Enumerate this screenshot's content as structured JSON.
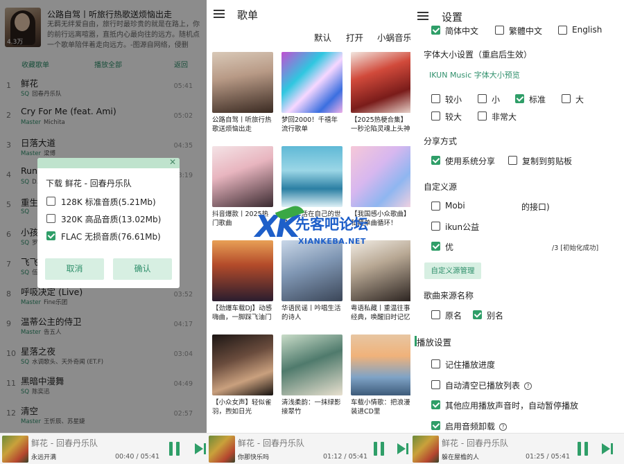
{
  "panel1": {
    "playlist_title": "公路自驾丨听旅行热歌送烦恼出走",
    "playlist_desc": "无羁无绊爱自由，旅行时最珍贵的就是在路上，你的前行远离喧嚣，直抵内心最向往的远方。随机点一个歌单陪伴着走向远方。-图源自网络，侵删",
    "play_count": "4.3万",
    "actions": {
      "collect": "收藏歌单",
      "play_all": "播放全部",
      "back": "返回"
    },
    "songs": [
      {
        "num": "1",
        "name": "鲜花",
        "tag": "SQ",
        "artist": "回春丹乐队",
        "dur": "05:41"
      },
      {
        "num": "2",
        "name": "Cry For Me (feat. Ami)",
        "tag": "Master",
        "artist": "Michita",
        "dur": "05:02"
      },
      {
        "num": "3",
        "name": "日落大道",
        "tag": "Master",
        "artist": "梁博",
        "dur": "04:35"
      },
      {
        "num": "4",
        "name": "Run",
        "tag": "SQ",
        "artist": "D.L",
        "dur": "03:19"
      },
      {
        "num": "5",
        "name": "重生",
        "tag": "SQ",
        "artist": "",
        "dur": ""
      },
      {
        "num": "6",
        "name": "小孩",
        "tag": "SQ",
        "artist": "罗",
        "dur": ""
      },
      {
        "num": "7",
        "name": "飞飞",
        "tag": "SQ",
        "artist": "伍",
        "dur": ""
      },
      {
        "num": "8",
        "name": "呼吸决定 (Live)",
        "tag": "Master",
        "artist": "Fine乐团",
        "dur": "03:52"
      },
      {
        "num": "9",
        "name": "温蒂公主的侍卫",
        "tag": "Master",
        "artist": "告五人",
        "dur": "04:17"
      },
      {
        "num": "10",
        "name": "星落之夜",
        "tag": "SQ",
        "artist": "水调歌头、天外奇闻 (ET.F)",
        "dur": "03:04"
      },
      {
        "num": "11",
        "name": "黑暗中漫舞",
        "tag": "SQ",
        "artist": "陈奕迅",
        "dur": "04:49"
      },
      {
        "num": "12",
        "name": "清空",
        "tag": "Master",
        "artist": "王忻辰、苏星婕",
        "dur": "02:57"
      }
    ],
    "dialog": {
      "title": "下载 鲜花 - 回春丹乐队",
      "options": [
        {
          "label": "128K 标准音质(5.21Mb)",
          "checked": false
        },
        {
          "label": "320K 高品音质(13.02Mb)",
          "checked": false
        },
        {
          "label": "FLAC 无损音质(76.61Mb)",
          "checked": true
        }
      ],
      "cancel": "取消",
      "confirm": "确认"
    },
    "player": {
      "title": "鲜花 - 回春丹乐队",
      "sub": "永远开满",
      "time": "00:40 / 05:41"
    }
  },
  "panel2": {
    "title": "歌单",
    "tabs": [
      "默认",
      "打开",
      "小蜗音乐"
    ],
    "cards": [
      {
        "text": "公路自驾丨听旅行热歌送烦恼出走"
      },
      {
        "text": "梦回2000！千禧年流行歌单"
      },
      {
        "text": "【2025热梗合集】一秒沦陷灵魂上头神曲"
      },
      {
        "text": "抖音爆款丨2025热门歌曲"
      },
      {
        "text": "孤岛丨活在自己的世界"
      },
      {
        "text": "【我国感小众歌曲】私藏单曲循环！"
      },
      {
        "text": "【劲爆车载DJ】动感嗨曲，一脚踩飞油门"
      },
      {
        "text": "华语民谣丨吟唱生活的诗人"
      },
      {
        "text": "粤语私藏丨重温往事经典，唤醒旧时记忆"
      },
      {
        "text": "【小众女声】轻似雀羽，煦如日光"
      },
      {
        "text": "清浅柔韵：一抹绿影接翠竹"
      },
      {
        "text": "车载小情歌：把浪漫装进CD里"
      }
    ],
    "player": {
      "title": "鲜花 - 回春丹乐队",
      "sub": "你那快乐吗",
      "time": "01:12 / 05:41"
    }
  },
  "watermark": {
    "brand_cn": "先客吧论坛",
    "brand_en": "XIANKEBA.NET",
    "logo": "XK"
  },
  "panel3": {
    "title": "设置",
    "lang_opts": [
      {
        "label": "简体中文",
        "checked": true
      },
      {
        "label": "繁體中文",
        "checked": false
      },
      {
        "label": "English",
        "checked": false
      }
    ],
    "font_section": "字体大小设置（重启后生效）",
    "font_preview": "IKUN Music 字体大小预览",
    "font_opts": [
      {
        "label": "较小",
        "checked": false
      },
      {
        "label": "小",
        "checked": false
      },
      {
        "label": "标准",
        "checked": true
      },
      {
        "label": "大",
        "checked": false
      },
      {
        "label": "较大",
        "checked": false
      },
      {
        "label": "非常大",
        "checked": false
      }
    ],
    "share_section": "分享方式",
    "share_opts": [
      {
        "label": "使用系统分享",
        "checked": true
      },
      {
        "label": "复制到剪贴板",
        "checked": false
      }
    ],
    "source_section": "自定义源",
    "source_opts": [
      {
        "label_a": "Mobi",
        "label_b": "的接口)",
        "checked": false
      },
      {
        "label_a": "ikun公益",
        "label_b": "",
        "checked": false
      },
      {
        "label_a": "优",
        "label_b": "/3 [初始化成功]",
        "checked": true
      }
    ],
    "source_manage": "自定义源管理",
    "name_section": "歌曲来源名称",
    "name_opts": [
      {
        "label": "原名",
        "checked": false
      },
      {
        "label": "别名",
        "checked": true
      }
    ],
    "play_section": "播放设置",
    "play_opts": [
      {
        "label": "记住播放进度",
        "checked": false,
        "help": false
      },
      {
        "label": "自动清空已播放列表",
        "checked": false,
        "help": true
      },
      {
        "label": "其他应用播放声音时，自动暂停播放",
        "checked": true,
        "help": false
      },
      {
        "label": "启用音频卸载",
        "checked": true,
        "help": true
      }
    ],
    "player": {
      "title": "鲜花 - 回春丹乐队",
      "sub": "躲在屋檐的人",
      "time": "01:25 / 05:41"
    }
  },
  "colors": {
    "accent": "#2f9e68",
    "accent_light": "#d7efe2",
    "link": "#2f8f6b"
  }
}
